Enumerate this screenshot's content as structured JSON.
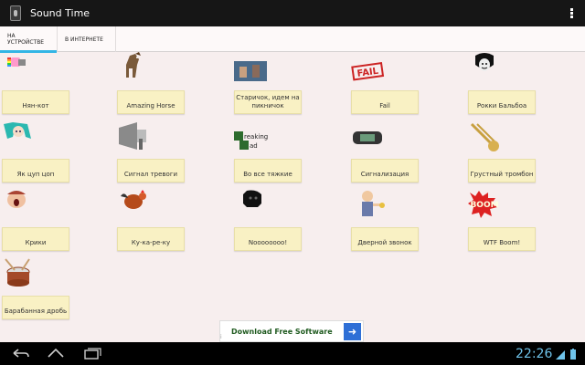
{
  "app": {
    "title": "Sound Time"
  },
  "tabs": [
    {
      "label": "НА УСТРОЙСТВЕ",
      "active": true
    },
    {
      "label": "В ИНТЕРНЕТЕ",
      "active": false
    }
  ],
  "sounds": [
    {
      "label": "Нян-кот",
      "icon": "nyan-cat-icon"
    },
    {
      "label": "Amazing Horse",
      "icon": "horse-icon"
    },
    {
      "label": "Старичок, идем на пикничок",
      "icon": "picnic-photo-icon"
    },
    {
      "label": "Fail",
      "icon": "fail-stamp-icon"
    },
    {
      "label": "Рокки Бальбоа",
      "icon": "rocky-face-icon"
    },
    {
      "label": "Як цуп цоп",
      "icon": "anime-girl-icon"
    },
    {
      "label": "Сигнал тревоги",
      "icon": "megaphone-icon"
    },
    {
      "label": "Во все тяжкие",
      "icon": "breaking-bad-logo-icon"
    },
    {
      "label": "Сигнализация",
      "icon": "car-alarm-remote-icon"
    },
    {
      "label": "Грустный тромбон",
      "icon": "trombone-icon"
    },
    {
      "label": "Крики",
      "icon": "screaming-face-icon"
    },
    {
      "label": "Ку-ка-ре-ку",
      "icon": "rooster-icon"
    },
    {
      "label": "Noooooooo!",
      "icon": "darth-vader-icon"
    },
    {
      "label": "Дверной звонок",
      "icon": "doorbell-man-icon"
    },
    {
      "label": "WTF Boom!",
      "icon": "boom-icon"
    },
    {
      "label": "Барабанная дробь",
      "icon": "drum-icon"
    }
  ],
  "ad": {
    "text": "Download Free Software",
    "arrow": "➜",
    "choices": "i"
  },
  "status": {
    "time": "22:26"
  },
  "icons": {
    "accent": "#33b5e5",
    "clock": "#6fc3ea",
    "ad_button": "#2e6fd6"
  }
}
